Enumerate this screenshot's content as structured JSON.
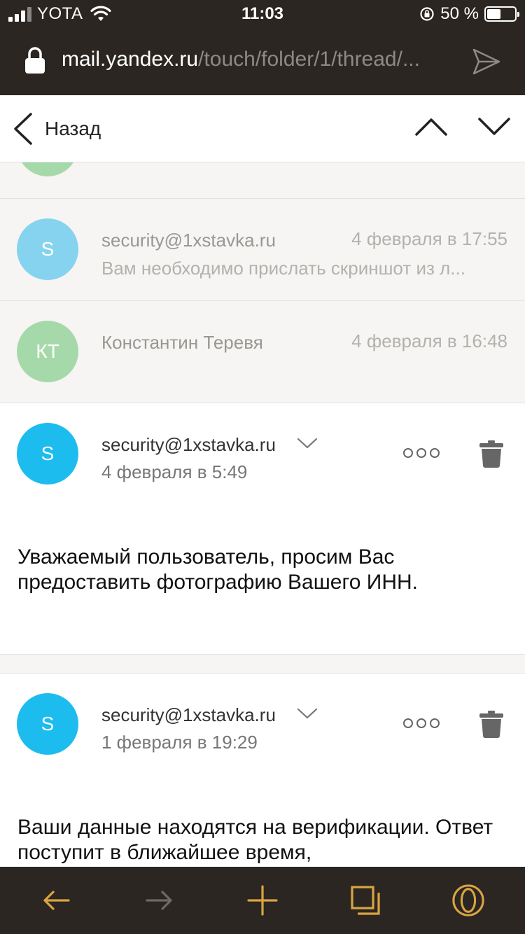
{
  "status_bar": {
    "carrier": "YOTA",
    "time": "11:03",
    "battery_text": "50 %",
    "battery_level": 0.5
  },
  "browser": {
    "url_host": "mail.yandex.ru",
    "url_path": "/touch/folder/1/thread/..."
  },
  "nav": {
    "back_label": "Назад"
  },
  "thread": [
    {
      "initials": "S",
      "sender": "security@1xstavka.ru",
      "date": "4 февраля в 17:55",
      "snippet": "Вам необходимо прислать скриншот из л...",
      "avatar_color": "#86d3ef"
    },
    {
      "initials": "КТ",
      "sender": "Константин Теревя",
      "date": "4 февраля в 16:48",
      "avatar_color": "#a6d9aa"
    }
  ],
  "messages": [
    {
      "initials": "S",
      "sender": "security@1xstavka.ru",
      "date": "4 февраля в 5:49",
      "body": "Уважаемый пользователь, просим Вас предоставить фотографию Вашего ИНН.",
      "avatar_color": "#1cbdee"
    },
    {
      "initials": "S",
      "sender": "security@1xstavka.ru",
      "date": "1 февраля в 19:29",
      "body": "Ваши данные находятся на верификации. Ответ поступит в ближайшее время,",
      "avatar_color": "#1cbdee"
    }
  ],
  "colors": {
    "chrome_bg": "#2b2622",
    "toolbar_accent": "#d9a441",
    "toolbar_disabled": "#6e6964"
  }
}
